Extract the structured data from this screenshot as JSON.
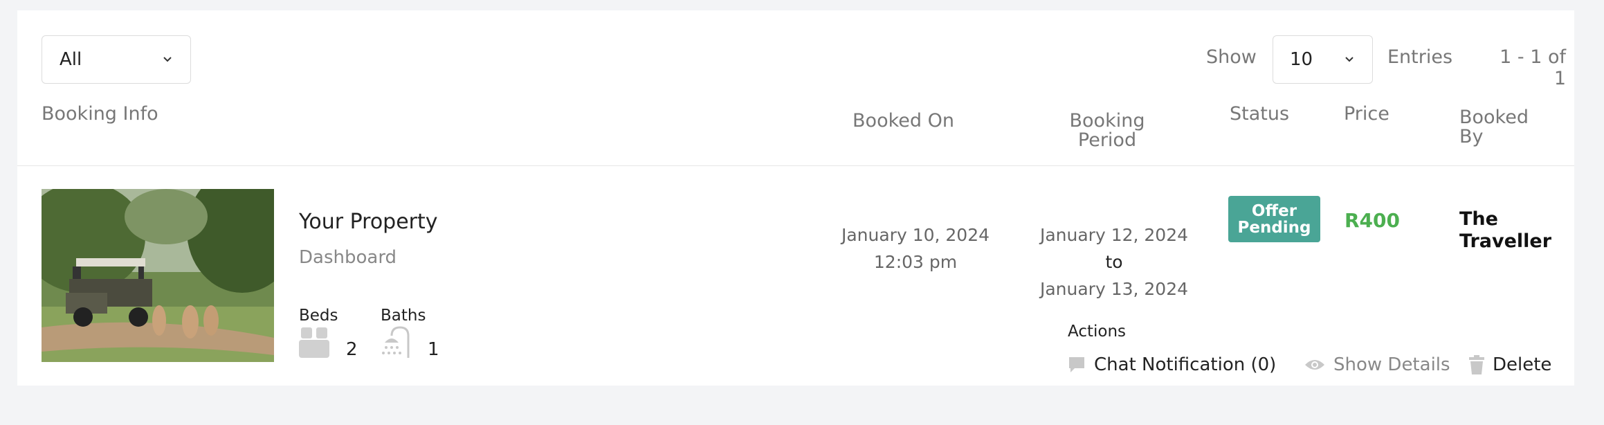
{
  "filter": {
    "value": "All"
  },
  "entries": {
    "show_label": "Show",
    "value": "10",
    "entries_label": "Entries",
    "pager_text": "1 - 1 of 1"
  },
  "headers": {
    "booking_info": "Booking Info",
    "booked_on": "Booked On",
    "booking_period": "Booking Period",
    "status": "Status",
    "price": "Price",
    "booked_by": "Booked By"
  },
  "booking": {
    "property_name": "Your Property",
    "property_subtitle": "Dashboard",
    "beds_label": "Beds",
    "beds_count": "2",
    "baths_label": "Baths",
    "baths_count": "1",
    "booked_on_date": "January 10, 2024",
    "booked_on_time": "12:03 pm",
    "period_start": "January 12, 2024",
    "period_to": "to",
    "period_end": "January 13, 2024",
    "status_line1": "Offer",
    "status_line2": "Pending",
    "price": "R400",
    "booked_by_line1": "The",
    "booked_by_line2": "Traveller"
  },
  "actions": {
    "label": "Actions",
    "chat": "Chat Notification (0)",
    "details": "Show Details",
    "delete": "Delete"
  },
  "colors": {
    "status_badge": "#4aa596",
    "price": "#4caf50",
    "background": "#f3f4f6"
  },
  "icons": [
    "chevron-down-icon",
    "bed-icon",
    "shower-icon",
    "chat-icon",
    "eye-icon",
    "trash-icon"
  ]
}
